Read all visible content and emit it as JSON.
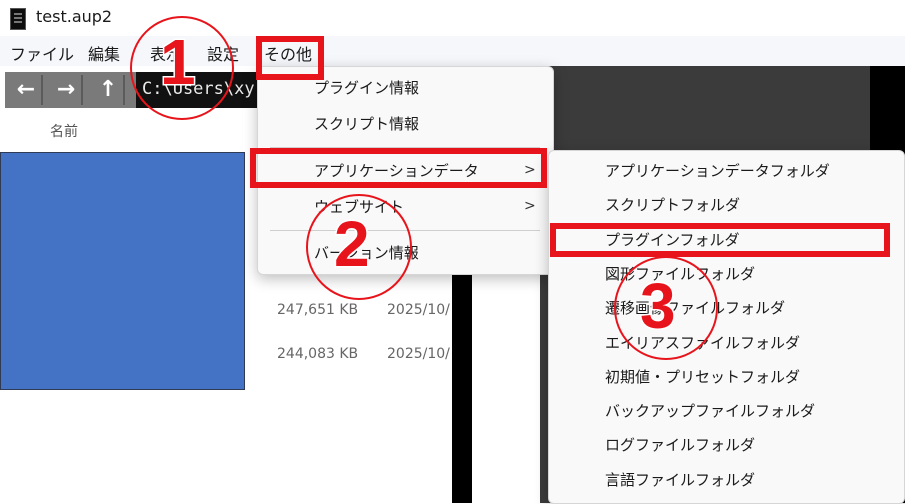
{
  "window": {
    "title": "test.aup2"
  },
  "menubar": {
    "items": [
      "ファイル",
      "編集",
      "表示",
      "設定",
      "その他"
    ]
  },
  "navbar": {
    "back": "←",
    "forward": "→",
    "up": "↑",
    "path": "C:\\Users\\xy"
  },
  "file_panel": {
    "column_name": "名前"
  },
  "file_list": [
    {
      "size": "247,651 KB",
      "date": "2025/10/"
    },
    {
      "size": "244,083 KB",
      "date": "2025/10/"
    }
  ],
  "menu_other": {
    "items": [
      "プラグイン情報",
      "スクリプト情報",
      "アプリケーションデータ",
      "ウェブサイト",
      "バージョン情報"
    ],
    "submenu_arrow": ">"
  },
  "submenu_appdata": {
    "items": [
      "アプリケーションデータフォルダ",
      "スクリプトフォルダ",
      "プラグインフォルダ",
      "図形ファイルフォルダ",
      "遷移画像ファイルフォルダ",
      "エイリアスファイルフォルダ",
      "初期値・プリセットフォルダ",
      "バックアップファイルフォルダ",
      "ログファイルフォルダ",
      "言語ファイルフォルダ"
    ]
  },
  "annotations": {
    "step1": "1",
    "step2": "2",
    "step3": "3",
    "color": "#e8141b"
  }
}
